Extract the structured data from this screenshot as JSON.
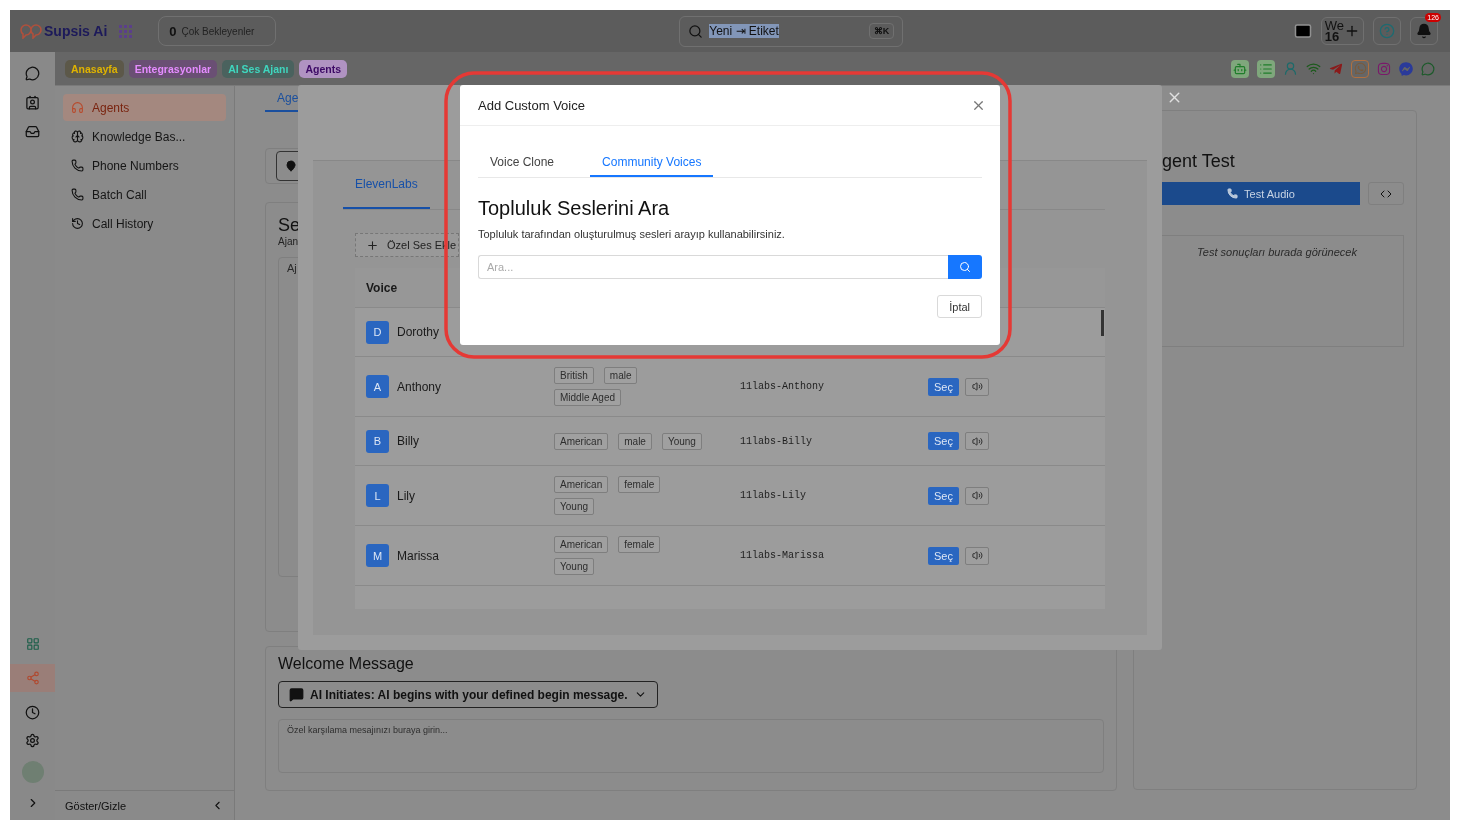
{
  "topbar": {
    "logo": "Supsis Ai",
    "pending": {
      "count": "0",
      "label": "Çok Bekleyenler"
    },
    "search": {
      "value": "Yeni ⇥ Etiket",
      "shortcut": "⌘K"
    },
    "user_badge": {
      "initials": "We",
      "count": "16"
    },
    "notification_count": "126"
  },
  "quick_tags": [
    {
      "label": "Anasayfa",
      "color": "#5c5849"
    },
    {
      "label": "Entegrasyonlar",
      "color": "#6a4f74"
    },
    {
      "label": "AI Ses Ajanı",
      "color": "#4a625e"
    },
    {
      "label": "Agents",
      "color": "#b093c2"
    }
  ],
  "sidebar": {
    "items": [
      {
        "label": "Agents",
        "selected": true
      },
      {
        "label": "Knowledge Bas...",
        "selected": false
      },
      {
        "label": "Phone Numbers",
        "selected": false
      },
      {
        "label": "Batch Call",
        "selected": false
      },
      {
        "label": "Call History",
        "selected": false
      }
    ],
    "toggle_label": "Göster/Gizle"
  },
  "page": {
    "tab": "Age",
    "section_title": "Se",
    "section_subtitle": "Ajan",
    "section_input": "Aj"
  },
  "welcome": {
    "title": "Welcome Message",
    "mode": "AI Initiates: AI begins with your defined begin message.",
    "placeholder": "Özel karşılama mesajınızı buraya girin..."
  },
  "test_panel": {
    "title": "gent Test",
    "button": "Test Audio",
    "results": "Test sonuçları burada görünecek"
  },
  "voice_modal": {
    "tabs": [
      {
        "label": "ElevenLabs",
        "selected": true
      }
    ],
    "add_button": "Özel Ses Ekle",
    "columns": [
      "Voice"
    ],
    "rows": [
      {
        "initial": "D",
        "name": "Dorothy"
      },
      {
        "initial": "A",
        "name": "Anthony",
        "tags": [
          "British",
          "male",
          "Middle Aged"
        ],
        "voice_id": "11labs-Anthony",
        "select": "Seç"
      },
      {
        "initial": "B",
        "name": "Billy",
        "tags": [
          "American",
          "male",
          "Young"
        ],
        "voice_id": "11labs-Billy",
        "select": "Seç"
      },
      {
        "initial": "L",
        "name": "Lily",
        "tags": [
          "American",
          "female",
          "Young"
        ],
        "voice_id": "11labs-Lily",
        "select": "Seç"
      },
      {
        "initial": "M",
        "name": "Marissa",
        "tags": [
          "American",
          "female",
          "Young"
        ],
        "voice_id": "11labs-Marissa",
        "select": "Seç"
      }
    ]
  },
  "custom_voice_modal": {
    "title": "Add Custom Voice",
    "tabs": [
      {
        "label": "Voice Clone",
        "selected": false
      },
      {
        "label": "Community Voices",
        "selected": true
      }
    ],
    "heading": "Topluluk Seslerini Ara",
    "description": "Topluluk tarafından oluşturulmuş sesleri arayıp kullanabilirsiniz.",
    "search_placeholder": "Ara...",
    "cancel": "İptal"
  }
}
